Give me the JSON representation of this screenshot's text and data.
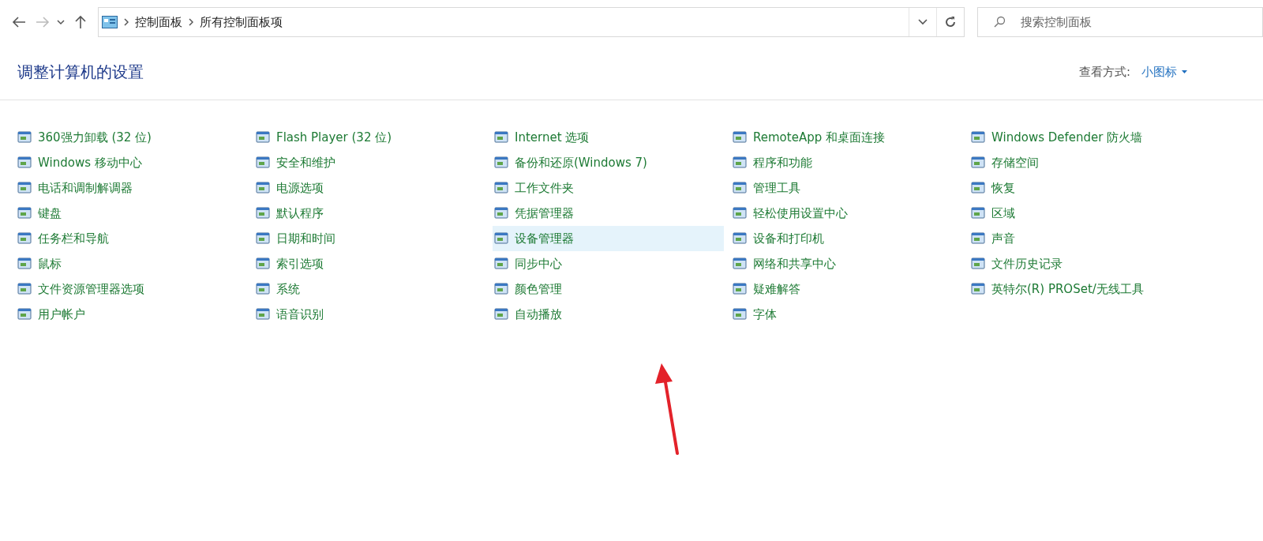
{
  "breadcrumb": [
    "控制面板",
    "所有控制面板项"
  ],
  "search": {
    "placeholder": "搜索控制面板"
  },
  "heading": "调整计算机的设置",
  "view_by": {
    "label": "查看方式:",
    "value": "小图标"
  },
  "items": [
    {
      "label": "360强力卸载 (32 位)",
      "selected": false
    },
    {
      "label": "Windows 移动中心",
      "selected": false
    },
    {
      "label": "电话和调制解调器",
      "selected": false
    },
    {
      "label": "键盘",
      "selected": false
    },
    {
      "label": "任务栏和导航",
      "selected": false
    },
    {
      "label": "鼠标",
      "selected": false
    },
    {
      "label": "文件资源管理器选项",
      "selected": false
    },
    {
      "label": "用户帐户",
      "selected": false
    },
    {
      "label": "Flash Player (32 位)",
      "selected": false
    },
    {
      "label": "安全和维护",
      "selected": false
    },
    {
      "label": "电源选项",
      "selected": false
    },
    {
      "label": "默认程序",
      "selected": false
    },
    {
      "label": "日期和时间",
      "selected": false
    },
    {
      "label": "索引选项",
      "selected": false
    },
    {
      "label": "系统",
      "selected": false
    },
    {
      "label": "语音识别",
      "selected": false
    },
    {
      "label": "Internet 选项",
      "selected": false
    },
    {
      "label": "备份和还原(Windows 7)",
      "selected": false
    },
    {
      "label": "工作文件夹",
      "selected": false
    },
    {
      "label": "凭据管理器",
      "selected": false
    },
    {
      "label": "设备管理器",
      "selected": true
    },
    {
      "label": "同步中心",
      "selected": false
    },
    {
      "label": "颜色管理",
      "selected": false
    },
    {
      "label": "自动播放",
      "selected": false
    },
    {
      "label": "RemoteApp 和桌面连接",
      "selected": false
    },
    {
      "label": "程序和功能",
      "selected": false
    },
    {
      "label": "管理工具",
      "selected": false
    },
    {
      "label": "轻松使用设置中心",
      "selected": false
    },
    {
      "label": "设备和打印机",
      "selected": false
    },
    {
      "label": "网络和共享中心",
      "selected": false
    },
    {
      "label": "疑难解答",
      "selected": false
    },
    {
      "label": "字体",
      "selected": false
    },
    {
      "label": "Windows Defender 防火墙",
      "selected": false
    },
    {
      "label": "存储空间",
      "selected": false
    },
    {
      "label": "恢复",
      "selected": false
    },
    {
      "label": "区域",
      "selected": false
    },
    {
      "label": "声音",
      "selected": false
    },
    {
      "label": "文件历史记录",
      "selected": false
    },
    {
      "label": "英特尔(R) PROSet/无线工具",
      "selected": false
    }
  ]
}
